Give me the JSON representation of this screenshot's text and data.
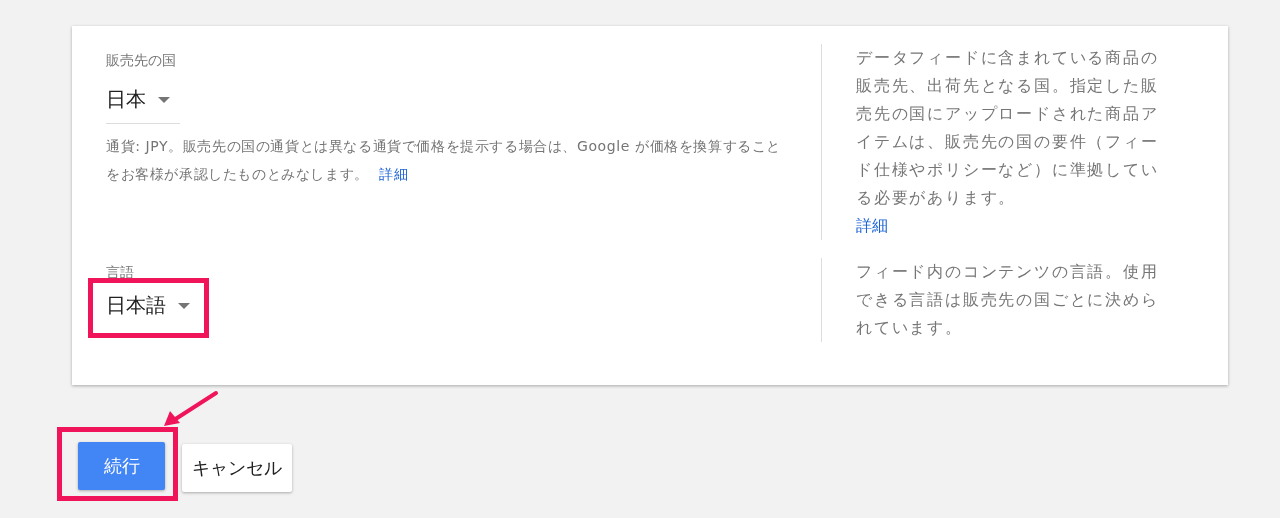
{
  "sections": [
    {
      "label": "販売先の国",
      "value": "日本",
      "underline": true,
      "highlighted": false,
      "help": "通貨: JPY。販売先の国の通貨とは異なる通貨で価格を提示する場合は、Google が価格を換算することをお客様が承認したものとみなします。",
      "help_link": "詳細",
      "description": "データフィードに含まれている商品の販売先、出荷先となる国。指定した販売先の国にアップロードされた商品アイテムは、販売先の国の要件（フィード仕様やポリシーなど）に準拠している必要があります。",
      "description_link": "詳細"
    },
    {
      "label": "言語",
      "value": "日本語",
      "underline": false,
      "highlighted": true,
      "description": "フィード内のコンテンツの言語。使用できる言語は販売先の国ごとに決められています。"
    }
  ],
  "buttons": [
    {
      "label": "続行",
      "kind": "primary",
      "highlighted": true
    },
    {
      "label": "キャンセル",
      "kind": "secondary",
      "highlighted": false
    }
  ],
  "arrow": true
}
